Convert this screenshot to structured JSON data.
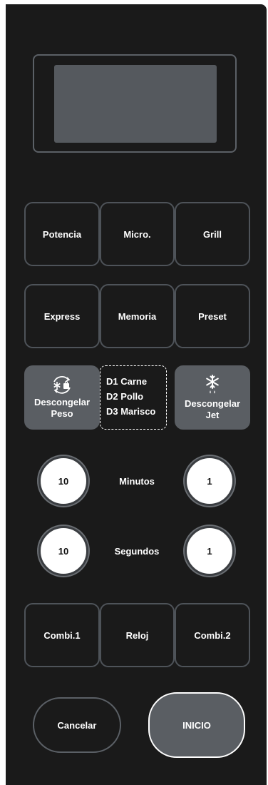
{
  "row1": {
    "potencia": "Potencia",
    "micro": "Micro.",
    "grill": "Grill"
  },
  "row2": {
    "express": "Express",
    "memoria": "Memoria",
    "preset": "Preset"
  },
  "defrost": {
    "peso_line1": "Descongelar",
    "peso_line2": "Peso",
    "jet_line1": "Descongelar",
    "jet_line2": "Jet",
    "options": [
      "D1 Carne",
      "D2 Pollo",
      "D3 Marisco"
    ],
    "peso_icon": "defrost-weight-icon",
    "jet_icon": "snowflake-drops-icon"
  },
  "minutes": {
    "label": "Minutos",
    "ten": "10",
    "one": "1"
  },
  "seconds": {
    "label": "Segundos",
    "ten": "10",
    "one": "1"
  },
  "row3": {
    "combi1": "Combi.1",
    "reloj": "Reloj",
    "combi2": "Combi.2"
  },
  "bottom": {
    "cancel": "Cancelar",
    "start": "INICIO"
  },
  "colors": {
    "panel": "#1a1a1a",
    "border": "#4e5359",
    "lcd": "#55595e",
    "filled_key": "#5a5e63",
    "text": "#ffffff"
  }
}
